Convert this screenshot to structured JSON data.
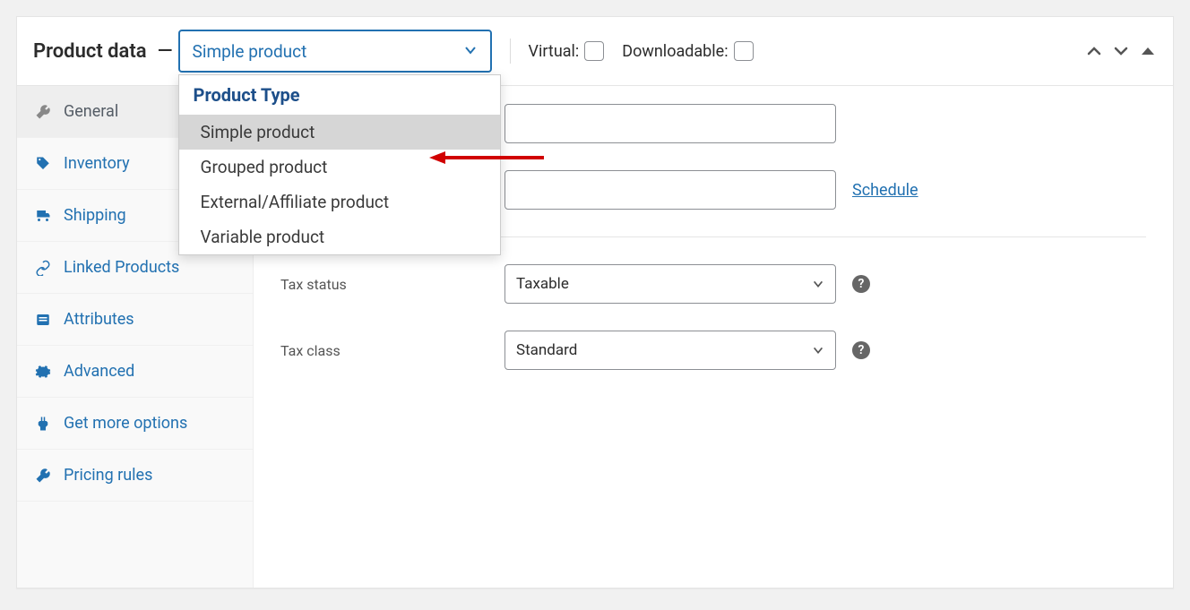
{
  "panel": {
    "title": "Product data",
    "dash": "—"
  },
  "type_select": {
    "value": "Simple product",
    "group_label": "Product Type",
    "options": [
      "Simple product",
      "Grouped product",
      "External/Affiliate product",
      "Variable product"
    ]
  },
  "toggles": {
    "virtual": "Virtual:",
    "downloadable": "Downloadable:"
  },
  "sidebar": {
    "tabs": [
      {
        "label": "General"
      },
      {
        "label": "Inventory"
      },
      {
        "label": "Shipping"
      },
      {
        "label": "Linked Products"
      },
      {
        "label": "Attributes"
      },
      {
        "label": "Advanced"
      },
      {
        "label": "Get more options"
      },
      {
        "label": "Pricing rules"
      }
    ]
  },
  "fields": {
    "tax_status_label": "Tax status",
    "tax_status_value": "Taxable",
    "tax_class_label": "Tax class",
    "tax_class_value": "Standard",
    "schedule": "Schedule"
  }
}
